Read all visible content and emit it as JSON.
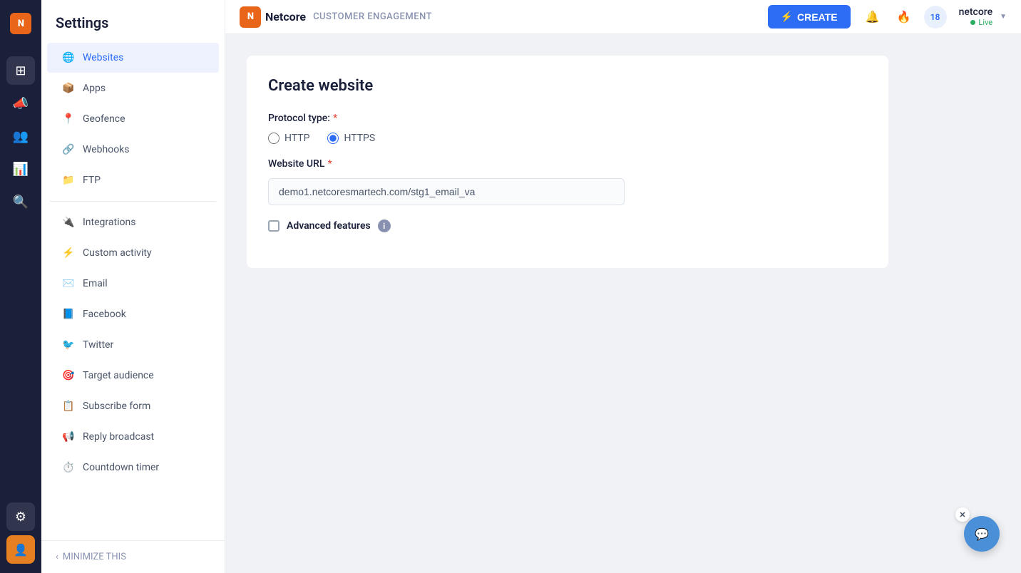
{
  "brand": {
    "name": "Netcore",
    "product": "CUSTOMER ENGAGEMENT"
  },
  "topnav": {
    "create_label": "CREATE",
    "user_name": "netcore",
    "live_status": "Live",
    "notification_count": "18"
  },
  "sidebar": {
    "title": "Settings",
    "items": [
      {
        "id": "websites",
        "label": "Websites",
        "icon": "🌐"
      },
      {
        "id": "apps",
        "label": "Apps",
        "icon": "📦"
      },
      {
        "id": "geofence",
        "label": "Geofence",
        "icon": "📍"
      },
      {
        "id": "webhooks",
        "label": "Webhooks",
        "icon": "🔗"
      },
      {
        "id": "ftp",
        "label": "FTP",
        "icon": "📁"
      },
      {
        "id": "integrations",
        "label": "Integrations",
        "icon": "🔌"
      },
      {
        "id": "custom-activity",
        "label": "Custom activity",
        "icon": "⚡"
      },
      {
        "id": "email",
        "label": "Email",
        "icon": "✉️"
      },
      {
        "id": "facebook",
        "label": "Facebook",
        "icon": "📘"
      },
      {
        "id": "twitter",
        "label": "Twitter",
        "icon": "🐦"
      },
      {
        "id": "target-audience",
        "label": "Target audience",
        "icon": "🎯"
      },
      {
        "id": "subscribe-form",
        "label": "Subscribe form",
        "icon": "📋"
      },
      {
        "id": "reply-broadcast",
        "label": "Reply broadcast",
        "icon": "📢"
      },
      {
        "id": "countdown-timer",
        "label": "Countdown timer",
        "icon": "⏱️"
      }
    ],
    "minimize_label": "MINIMIZE THIS"
  },
  "page": {
    "title": "Create website",
    "protocol_label": "Protocol type:",
    "http_label": "HTTP",
    "https_label": "HTTPS",
    "url_label": "Website URL",
    "url_value": "demo1.netcoresmartech.com/stg1_email_va",
    "advanced_features_label": "Advanced features"
  }
}
